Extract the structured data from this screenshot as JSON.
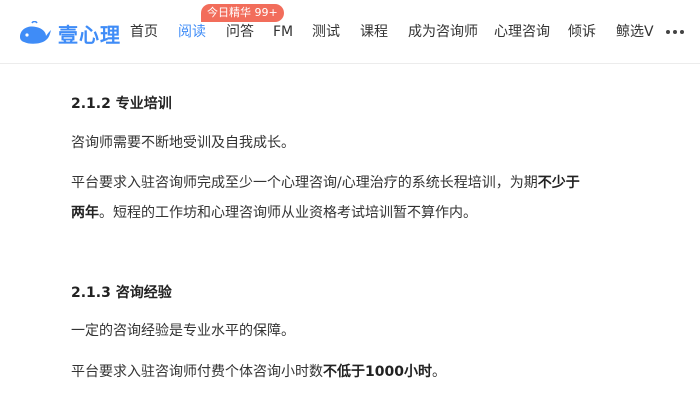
{
  "brand": {
    "name": "壹心理",
    "color": "#3f8cf7"
  },
  "nav": {
    "items": [
      {
        "label": "首页",
        "active": false
      },
      {
        "label": "阅读",
        "active": true
      },
      {
        "label": "问答",
        "active": false
      },
      {
        "label": "FM",
        "active": false
      },
      {
        "label": "测试",
        "active": false
      },
      {
        "label": "课程",
        "active": false
      },
      {
        "label": "成为咨询师",
        "active": false
      },
      {
        "label": "心理咨询",
        "active": false
      },
      {
        "label": "倾诉",
        "active": false
      },
      {
        "label": "鲸选V",
        "active": false
      }
    ],
    "badge": "今日精华 99+",
    "more_icon": "more-dots-icon"
  },
  "article": {
    "section_1": {
      "heading": "2.1.2 专业培训",
      "p1": "咨询师需要不断地受训及自我成长。",
      "p2_a": "平台要求入驻咨询师完成至少一个心理咨询/心理治疗的系统长程培训，为期",
      "p2_bold": "不少于两年",
      "p2_b": "。短程的工作坊和心理咨询师从业资格考试培训暂不算作内。"
    },
    "section_2": {
      "heading": "2.1.3 咨询经验",
      "p1": "一定的咨询经验是专业水平的保障。",
      "p2_a": "平台要求入驻咨询师付费个体咨询小时数",
      "p2_bold": "不低于1000小时",
      "p2_b": "。"
    }
  }
}
